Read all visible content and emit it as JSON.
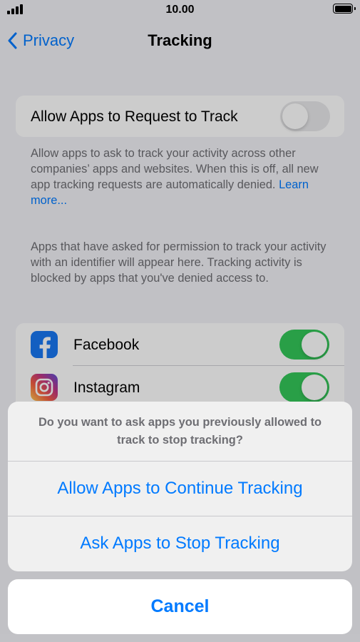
{
  "status_bar": {
    "time": "10.00"
  },
  "nav": {
    "back_label": "Privacy",
    "title": "Tracking"
  },
  "track_setting": {
    "label": "Allow Apps to Request to Track",
    "enabled": false
  },
  "track_footnote": {
    "text": "Allow apps to ask to track your activity across other companies’ apps and websites. When this is off, all new app tracking requests are automatically denied.",
    "link": "Learn more..."
  },
  "apps_footnote": "Apps that have asked for permission to track your activity with an identifier will appear here. Tracking activity is blocked by apps that you've denied access to.",
  "apps": [
    {
      "name": "Facebook",
      "icon": "facebook-icon",
      "enabled": true
    },
    {
      "name": "Instagram",
      "icon": "instagram-icon",
      "enabled": true
    }
  ],
  "action_sheet": {
    "message_line1": "Do you want to ask apps you previously allowed to",
    "message_line2": "track to stop tracking?",
    "continue_label": "Allow Apps to Continue Tracking",
    "stop_label": "Ask Apps to Stop Tracking",
    "cancel_label": "Cancel"
  },
  "colors": {
    "accent": "#007aff",
    "switch_on": "#34c759",
    "switch_off": "#e9e9eb"
  }
}
